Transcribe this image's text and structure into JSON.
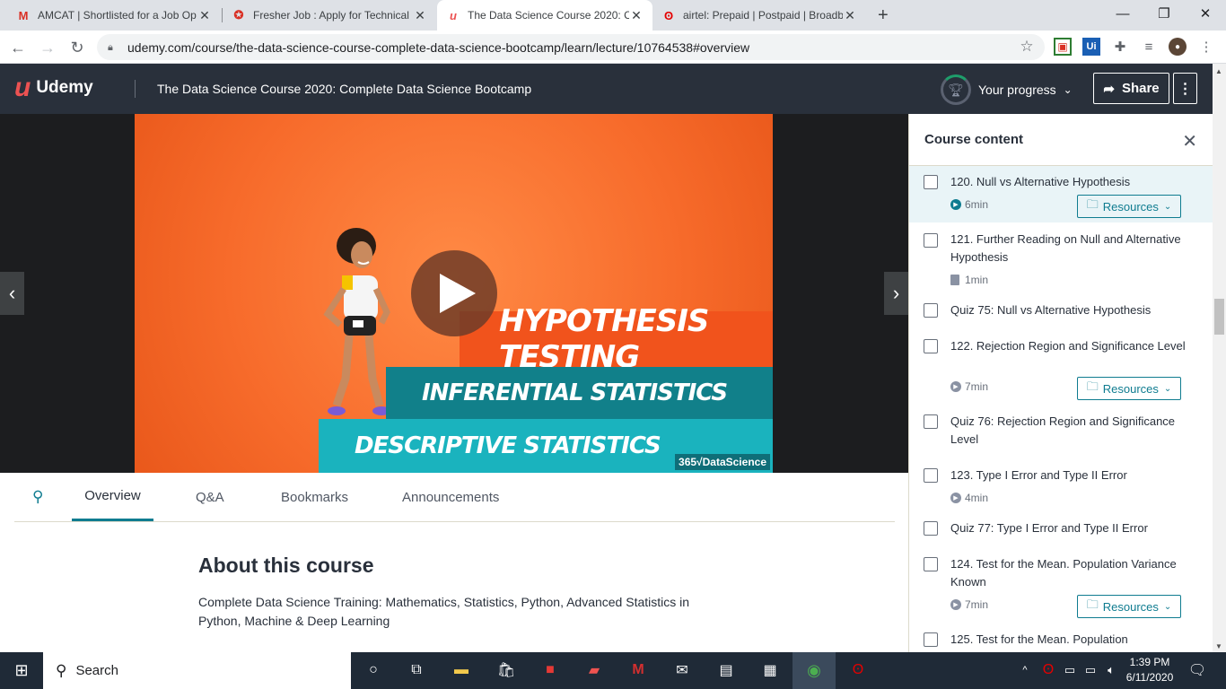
{
  "browser": {
    "tabs": [
      {
        "title": "AMCAT | Shortlisted for a Job Op",
        "favicon": "gmail-icon",
        "color": "#d93025"
      },
      {
        "title": "Fresher Job : Apply for Technical",
        "favicon": "freshersworld-icon",
        "color": "#d93025"
      },
      {
        "title": "The Data Science Course 2020: C",
        "favicon": "udemy-icon",
        "color": "#ec5252"
      },
      {
        "title": "airtel: Prepaid | Postpaid | Broadb",
        "favicon": "airtel-icon",
        "color": "#e40000"
      }
    ],
    "url": "udemy.com/course/the-data-science-course-complete-data-science-bootcamp/learn/lecture/10764538#overview"
  },
  "header": {
    "logo_text": "Udemy",
    "course_title": "The Data Science Course 2020: Complete Data Science Bootcamp",
    "progress_label": "Your progress",
    "share_label": "Share"
  },
  "video": {
    "banner1": "HYPOTHESIS TESTING",
    "banner2": "INFERENTIAL STATISTICS",
    "banner3": "DESCRIPTIVE STATISTICS",
    "brand": "365√DataScience"
  },
  "subnav": {
    "tabs": [
      "Overview",
      "Q&A",
      "Bookmarks",
      "Announcements"
    ],
    "active": "Overview"
  },
  "about": {
    "heading": "About this course",
    "description": "Complete Data Science Training: Mathematics, Statistics, Python, Advanced Statistics in Python, Machine & Deep Learning"
  },
  "sidebar": {
    "title": "Course content",
    "resources_label": "Resources",
    "items": [
      {
        "title": "120. Null vs Alternative Hypothesis",
        "meta": "6min",
        "type": "video",
        "resources": true,
        "current": true
      },
      {
        "title": "121. Further Reading on Null and Alternative Hypothesis",
        "meta": "1min",
        "type": "doc",
        "resources": false
      },
      {
        "title": "Quiz 75: Null vs Alternative Hypothesis",
        "meta": "",
        "type": "quiz",
        "resources": false
      },
      {
        "title": "122. Rejection Region and Significance Level",
        "meta": "7min",
        "type": "video",
        "resources": true
      },
      {
        "title": "Quiz 76: Rejection Region and Significance Level",
        "meta": "",
        "type": "quiz",
        "resources": false
      },
      {
        "title": "123. Type I Error and Type II Error",
        "meta": "4min",
        "type": "video",
        "resources": false
      },
      {
        "title": "Quiz 77: Type I Error and Type II Error",
        "meta": "",
        "type": "quiz",
        "resources": false
      },
      {
        "title": "124. Test for the Mean. Population Variance Known",
        "meta": "7min",
        "type": "video",
        "resources": true
      },
      {
        "title": "125. Test for the Mean. Population",
        "meta": "",
        "type": "video",
        "resources": false
      }
    ]
  },
  "taskbar": {
    "search_placeholder": "Search",
    "time": "1:39 PM",
    "date": "6/11/2020"
  }
}
